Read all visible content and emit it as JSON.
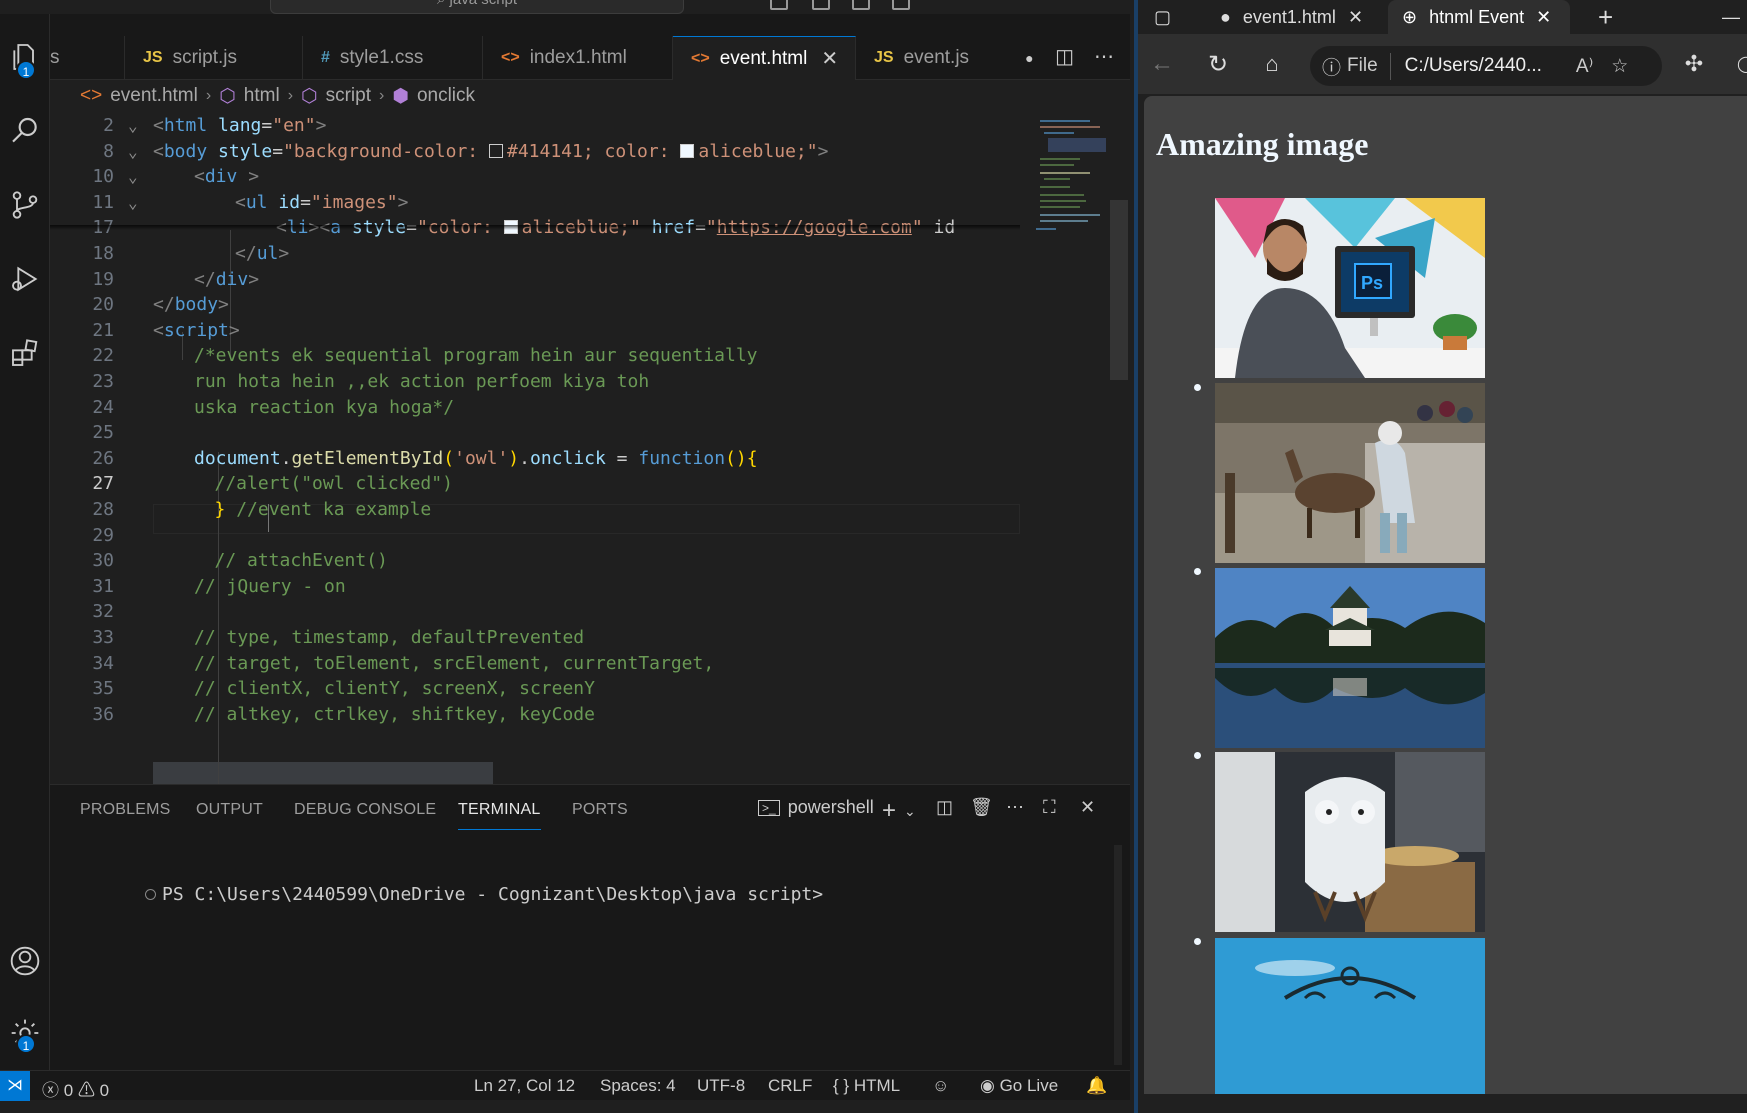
{
  "vscode": {
    "title_search": "java script",
    "tabs": [
      {
        "icon": "JS",
        "label": "s"
      },
      {
        "icon": "JS",
        "label": "script.js"
      },
      {
        "icon": "#",
        "label": "style1.css"
      },
      {
        "icon": "<>",
        "label": "index1.html"
      },
      {
        "icon": "<>",
        "label": "event.html",
        "active": true
      },
      {
        "icon": "JS",
        "label": "event.js"
      }
    ],
    "breadcrumb": [
      "event.html",
      "html",
      "script",
      "onclick"
    ],
    "activity_badges": {
      "explorer": "1",
      "settings": "1"
    },
    "editor_lines": [
      {
        "n": "2",
        "t": "<html lang=\"en\">"
      },
      {
        "n": "8",
        "t": "<body style=\"background-color: #414141; color: aliceblue;\">"
      },
      {
        "n": "10",
        "t": "<div >"
      },
      {
        "n": "11",
        "t": "<ul id=\"images\">"
      },
      {
        "n": "17",
        "t": "<li><a style=\"color: aliceblue;\" href=\"https://google.com\" id"
      },
      {
        "n": "18",
        "t": "</ul>"
      },
      {
        "n": "19",
        "t": "</div>"
      },
      {
        "n": "20",
        "t": "</body>"
      },
      {
        "n": "21",
        "t": "<script>"
      },
      {
        "n": "22",
        "t": "/*events ek sequential program hein aur sequentially"
      },
      {
        "n": "23",
        "t": "run hota hein ,,ek action perfoem kiya toh"
      },
      {
        "n": "24",
        "t": "uska reaction kya hoga*/"
      },
      {
        "n": "25",
        "t": ""
      },
      {
        "n": "26",
        "t": "document.getElementById('owl').onclick = function(){"
      },
      {
        "n": "27",
        "t": "//alert(\"owl clicked\")"
      },
      {
        "n": "28",
        "t": "} //event ka example"
      },
      {
        "n": "29",
        "t": ""
      },
      {
        "n": "30",
        "t": "// attachEvent()"
      },
      {
        "n": "31",
        "t": "// jQuery - on"
      },
      {
        "n": "32",
        "t": ""
      },
      {
        "n": "33",
        "t": "// type, timestamp, defaultPrevented"
      },
      {
        "n": "34",
        "t": "// target, toElement, srcElement, currentTarget,"
      },
      {
        "n": "35",
        "t": "// clientX, clientY, screenX, screenY"
      },
      {
        "n": "36",
        "t": "// altkey, ctrlkey, shiftkey, keyCode"
      }
    ],
    "panel": {
      "tabs": [
        "PROBLEMS",
        "OUTPUT",
        "DEBUG CONSOLE",
        "TERMINAL",
        "PORTS"
      ],
      "active_tab": "TERMINAL",
      "shell": "powershell",
      "prompt": "PS C:\\Users\\2440599\\OneDrive - Cognizant\\Desktop\\java script>"
    },
    "status": {
      "errors": "0",
      "warnings": "0",
      "position": "Ln 27, Col 12",
      "spaces": "Spaces: 4",
      "encoding": "UTF-8",
      "eol": "CRLF",
      "language": "HTML",
      "golive": "Go Live"
    }
  },
  "browser": {
    "tabs": [
      {
        "label": "event1.html",
        "icon": "github-icon"
      },
      {
        "label": "htnml Event",
        "icon": "globe-icon",
        "active": true
      }
    ],
    "address": {
      "scheme_label": "File",
      "url": "C:/Users/2440..."
    },
    "page": {
      "heading": "Amazing image",
      "images": [
        "photoshop-user",
        "girl-with-deer",
        "castle-reflection",
        "owl-figurine",
        "blue-sky-ornament"
      ]
    },
    "colors": {
      "page_bg": "#414141",
      "text": "aliceblue"
    }
  },
  "colors": {
    "accent": "#0078d4",
    "editor_bg": "#1f1f1f"
  }
}
